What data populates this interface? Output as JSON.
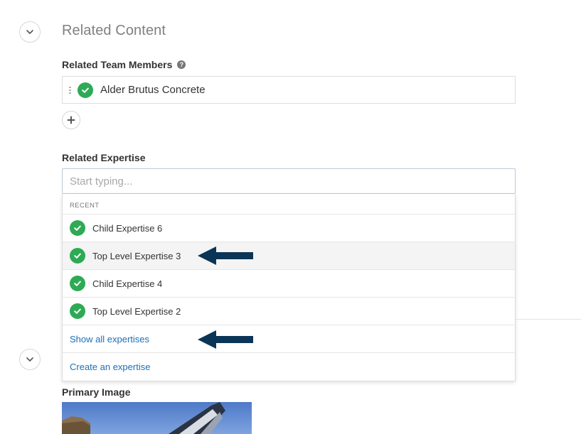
{
  "section": {
    "title": "Related Content"
  },
  "team_members": {
    "label": "Related Team Members",
    "help_glyph": "?",
    "items": [
      {
        "name": "Alder Brutus Concrete"
      }
    ]
  },
  "expertise": {
    "label": "Related Expertise",
    "search_placeholder": "Start typing...",
    "recent_header": "RECENT",
    "recent_items": [
      {
        "label": "Child Expertise 6"
      },
      {
        "label": "Top Level Expertise 3"
      },
      {
        "label": "Child Expertise 4"
      },
      {
        "label": "Top Level Expertise 2"
      }
    ],
    "show_all_label": "Show all expertises",
    "create_label": "Create an expertise"
  },
  "primary_image": {
    "label": "Primary Image"
  },
  "colors": {
    "check_green": "#2eaa55",
    "link_blue": "#1b6fb8",
    "arrow_navy": "#0b3556",
    "hover_row": "#f4f4f4"
  }
}
